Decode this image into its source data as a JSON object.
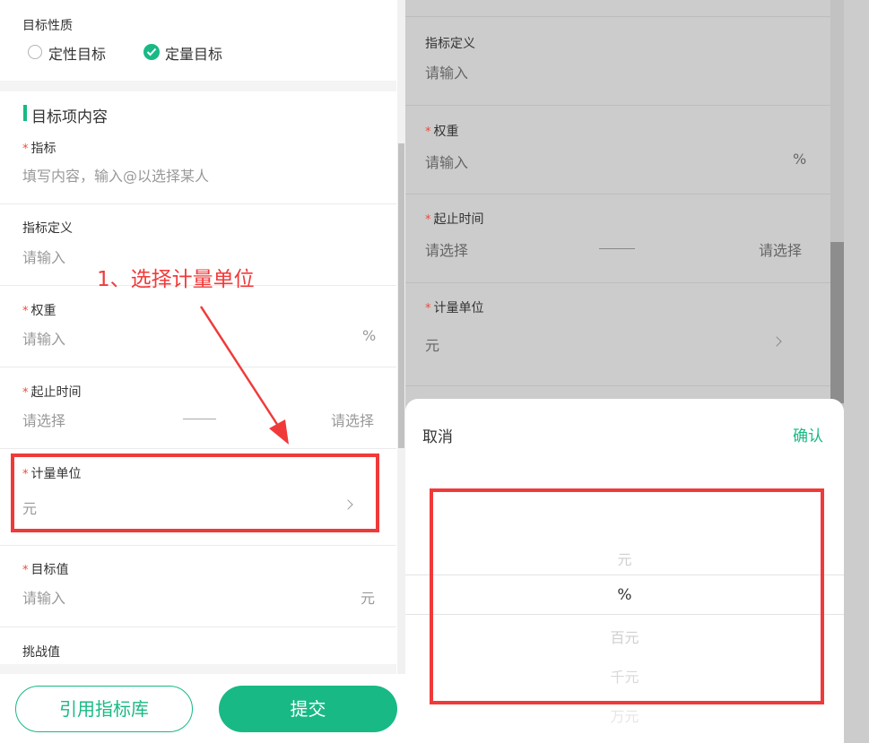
{
  "left": {
    "goal_nature_label": "目标性质",
    "radio_qualitative": "定性目标",
    "radio_quantitative": "定量目标",
    "section_title": "目标项内容",
    "required_mark": "*",
    "indicator_label": "指标",
    "indicator_placeholder": "填写内容，输入@以选择某人",
    "definition_label": "指标定义",
    "definition_placeholder": "请输入",
    "weight_label": "权重",
    "weight_placeholder": "请输入",
    "weight_unit": "%",
    "period_label": "起止时间",
    "period_start": "请选择",
    "period_end": "请选择",
    "unit_label": "计量单位",
    "unit_value": "元",
    "target_label": "目标值",
    "target_placeholder": "请输入",
    "target_unit": "元",
    "challenge_label": "挑战值",
    "btn_library": "引用指标库",
    "btn_submit": "提交"
  },
  "annotation": "1、选择计量单位",
  "right": {
    "definition_label": "指标定义",
    "definition_placeholder": "请输入",
    "weight_label": "权重",
    "weight_placeholder": "请输入",
    "weight_unit": "%",
    "period_label": "起止时间",
    "period_start": "请选择",
    "period_end": "请选择",
    "unit_label": "计量单位",
    "unit_value": "元",
    "sheet_cancel": "取消",
    "sheet_confirm": "确认",
    "options": [
      "元",
      "%",
      "百元",
      "千元",
      "万元"
    ],
    "selected_option": "%"
  },
  "colors": {
    "accent": "#18b985",
    "annotation": "#f03a3a",
    "required": "#f04a3a"
  }
}
